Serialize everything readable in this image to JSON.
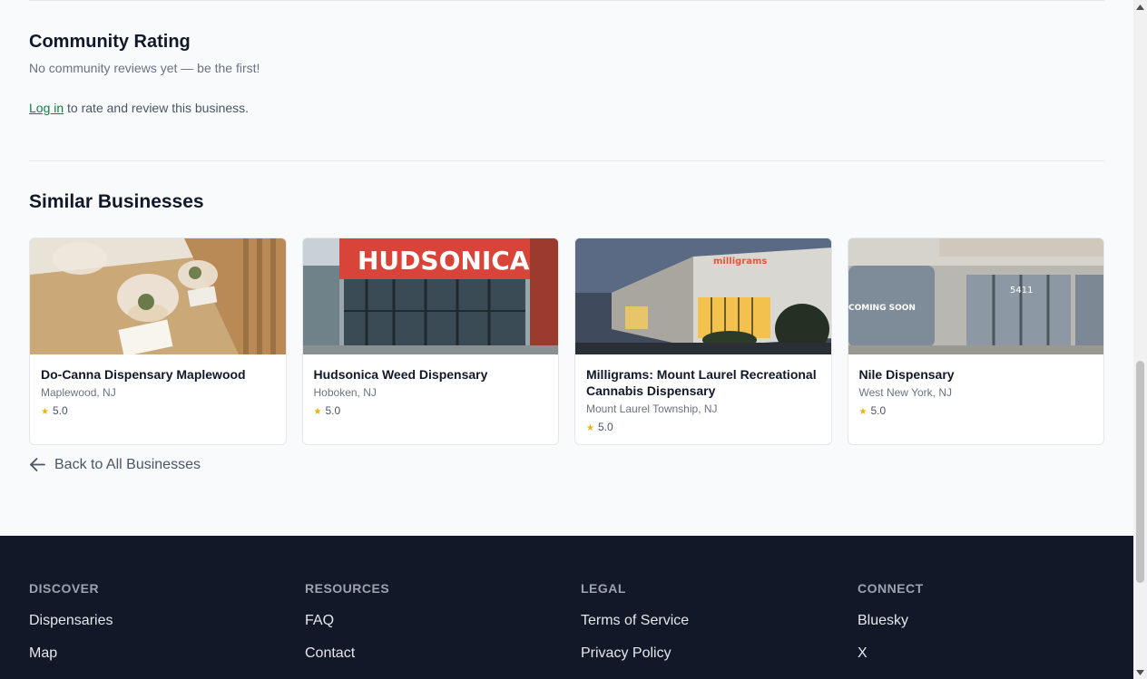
{
  "community": {
    "title": "Community Rating",
    "empty_text": "No community reviews yet — be the first!",
    "login_link": "Log in",
    "login_suffix": " to rate and review this business."
  },
  "similar": {
    "title": "Similar Businesses",
    "cards": [
      {
        "name": "Do-Canna Dispensary Maplewood",
        "location": "Maplewood, NJ",
        "rating": "5.0"
      },
      {
        "name": "Hudsonica Weed Dispensary",
        "location": "Hoboken, NJ",
        "rating": "5.0",
        "sign": "HUDSONICA"
      },
      {
        "name": "Milligrams: Mount Laurel Recreational Cannabis Dispensary",
        "location": "Mount Laurel Township, NJ",
        "rating": "5.0",
        "sign": "milligrams"
      },
      {
        "name": "Nile Dispensary",
        "location": "West New York, NJ",
        "rating": "5.0",
        "sign": "COMING SOON",
        "sign2": "5411"
      }
    ],
    "star_glyph": "★"
  },
  "back_link": "Back to All Businesses",
  "footer": {
    "discover": {
      "heading": "DISCOVER",
      "links": [
        "Dispensaries",
        "Map"
      ]
    },
    "resources": {
      "heading": "RESOURCES",
      "links": [
        "FAQ",
        "Contact"
      ]
    },
    "legal": {
      "heading": "LEGAL",
      "links": [
        "Terms of Service",
        "Privacy Policy"
      ]
    },
    "connect": {
      "heading": "CONNECT",
      "links": [
        "Bluesky",
        "X"
      ]
    }
  },
  "colors": {
    "link_green": "#15803d",
    "star": "#eab308",
    "footer_bg": "#111827"
  }
}
